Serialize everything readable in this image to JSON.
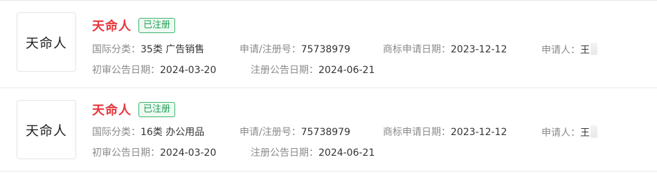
{
  "records": [
    {
      "logo_text": "天命人",
      "name": "天命人",
      "status": "已注册",
      "class_label": "国际分类：",
      "class_value": "35类 广告销售",
      "reg_label": "申请/注册号：",
      "reg_value": "75738979",
      "apply_date_label": "商标申请日期：",
      "apply_date_value": "2023-12-12",
      "applicant_label": "申请人：",
      "applicant_value": "王",
      "prelim_label": "初审公告日期：",
      "prelim_value": "2024-03-20",
      "reg_pub_label": "注册公告日期：",
      "reg_pub_value": "2024-06-21"
    },
    {
      "logo_text": "天命人",
      "name": "天命人",
      "status": "已注册",
      "class_label": "国际分类：",
      "class_value": "16类 办公用品",
      "reg_label": "申请/注册号：",
      "reg_value": "75738979",
      "apply_date_label": "商标申请日期：",
      "apply_date_value": "2023-12-12",
      "applicant_label": "申请人：",
      "applicant_value": "王",
      "prelim_label": "初审公告日期：",
      "prelim_value": "2024-03-20",
      "reg_pub_label": "注册公告日期：",
      "reg_pub_value": "2024-06-21"
    }
  ],
  "colors": {
    "name": "#e8363c",
    "badge_border": "#3db36b",
    "badge_text": "#1f9e55",
    "label": "#8a8a8a",
    "value": "#333333"
  }
}
